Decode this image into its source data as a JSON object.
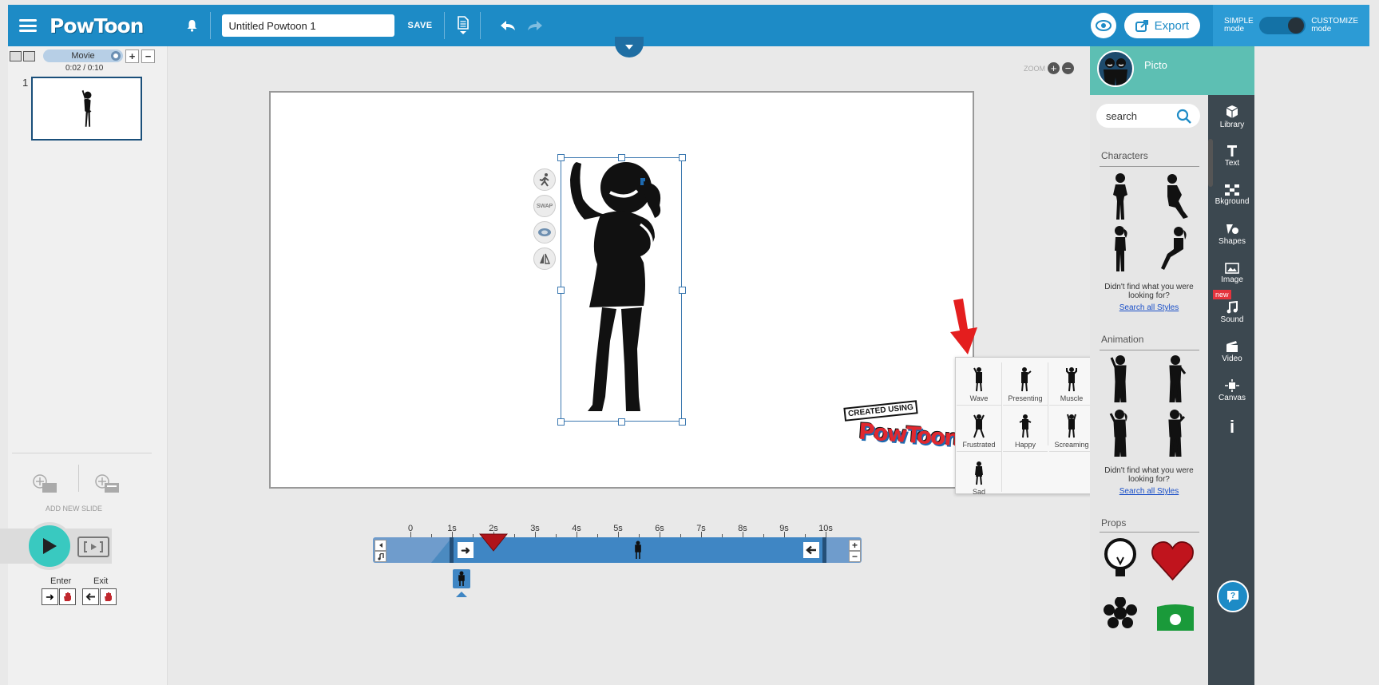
{
  "app": {
    "logo": "PowToon"
  },
  "topbar": {
    "title_value": "Untitled Powtoon 1",
    "save_label": "SAVE",
    "export_label": "Export",
    "simple_mode_line1": "SIMPLE",
    "simple_mode_line2": "mode",
    "customize_mode_line1": "CUSTOMIZE",
    "customize_mode_line2": "mode",
    "customize_mode_on": true
  },
  "left_panel": {
    "movie_label": "Movie",
    "time": "0:02 / 0:10",
    "slides": [
      {
        "number": "1"
      }
    ],
    "add_new_slide": "ADD NEW SLIDE",
    "enter_label": "Enter",
    "exit_label": "Exit"
  },
  "canvas": {
    "zoom_label": "ZOOM",
    "context_buttons": [
      "run-icon",
      "swap",
      "color-icon",
      "flip-icon"
    ],
    "swap_label": "SWAP",
    "watermark_line1": "CREATED USING",
    "watermark_line2": "PowToon"
  },
  "animation_popup": {
    "items": [
      {
        "label": "Wave"
      },
      {
        "label": "Presenting"
      },
      {
        "label": "Muscle"
      },
      {
        "label": "Frustrated"
      },
      {
        "label": "Happy"
      },
      {
        "label": "Screaming"
      },
      {
        "label": "Sad"
      }
    ]
  },
  "timeline": {
    "ticks": [
      "0",
      "1s",
      "2s",
      "3s",
      "4s",
      "5s",
      "6s",
      "7s",
      "8s",
      "9s",
      "10s"
    ],
    "playhead_seconds": 2,
    "duration_seconds": 10
  },
  "right_panel": {
    "style_name": "Picto",
    "search_placeholder": "search",
    "sections": {
      "characters": "Characters",
      "animation": "Animation",
      "props": "Props"
    },
    "not_found_line": "Didn't find what you were looking for?",
    "search_all_link": "Search all Styles"
  },
  "icon_bar": {
    "items": [
      "Library",
      "Text",
      "Bkground",
      "Shapes",
      "Image",
      "Sound",
      "Video",
      "Canvas"
    ],
    "new_badge": "new"
  },
  "colors": {
    "topbar": "#1d8bc6",
    "accent_teal": "#5dbfb3",
    "play": "#39c9c0",
    "timeline": "#3f86c4",
    "red": "#e5343d"
  }
}
